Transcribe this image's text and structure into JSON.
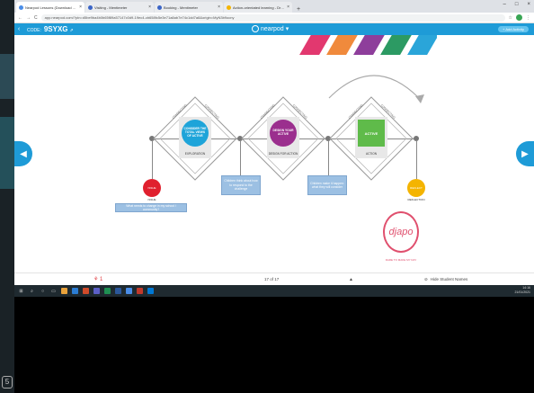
{
  "browser": {
    "tabs": [
      {
        "label": "Nearpod Lessons (Download Arc"
      },
      {
        "label": "Visiting - Mentimeter"
      },
      {
        "label": "Booking - Mentimeter"
      },
      {
        "label": "Action-orientated learning - Drive"
      }
    ],
    "new_tab": "+",
    "window_controls": [
      "–",
      "□",
      "×"
    ],
    "nav": [
      "←",
      "→",
      "C"
    ],
    "url": "app.nearpod.com/?pin=d5be9ba4b0b65f89a57147c0d9-19ec4-cb658fc5e3e71a8ab7e74c1dd7a8&origin=MyN3b9ocny"
  },
  "nearpod": {
    "code_label": "CODE:",
    "code": "9SYXG",
    "logo": "nearpod",
    "add_activity": "+ Add Activity",
    "back_icon": "chevron-left-icon"
  },
  "slide": {
    "stripe_colors": [
      "#e2386f",
      "#f08a3c",
      "#8e3e9b",
      "#2c9a63",
      "#2aa5d9"
    ],
    "steps": [
      {
        "text": "CONSIDER THE TOTAL VIEWS OF ACTIVE",
        "label": "EXPLORATION",
        "color": "#1ea4d9",
        "shape": "circle"
      },
      {
        "text": "DESIGN YOUR ACTIVE",
        "label": "DESIGN FOR ACTION",
        "color": "#9b2f8e",
        "shape": "circle"
      },
      {
        "text": "ACTIVE",
        "label": "ACTION",
        "color": "#5fbb4a",
        "shape": "square"
      }
    ],
    "edge_labels": [
      "CONNECTING",
      "CONNECTING",
      "CONNECTING",
      "CONNECTING",
      "CONNECTING",
      "CONNECTING",
      "CONNECTING",
      "CONNECTING"
    ],
    "outcomes": [
      {
        "text": "ISSUE",
        "label": "ISSUE",
        "color": "#e0202e"
      },
      {
        "text": "REFLECT",
        "label": "REFLECTION",
        "color": "#f4b400"
      }
    ],
    "notes": [
      "What needs to change in my school / community?",
      "Children think about how to respond to the challenge",
      "Children make it happen: what they will consider"
    ],
    "brand": {
      "name": "djapo",
      "tagline": "DARE TO MAKE MY DAY"
    }
  },
  "bottom_bar": {
    "reaction": "⚘ 1",
    "pager": "17 of 17",
    "caret": "▲",
    "hide_label": "Hide Student Names"
  },
  "taskbar": {
    "time": "14:16",
    "date": "21/01/2021"
  }
}
